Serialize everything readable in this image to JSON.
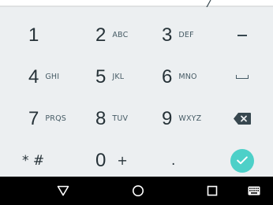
{
  "keypad": {
    "rows": [
      [
        {
          "num": "1",
          "sub": ""
        },
        {
          "num": "2",
          "sub": "ABC"
        },
        {
          "num": "3",
          "sub": "DEF"
        }
      ],
      [
        {
          "num": "4",
          "sub": "GHI"
        },
        {
          "num": "5",
          "sub": "JKL"
        },
        {
          "num": "6",
          "sub": "MNO"
        }
      ],
      [
        {
          "num": "7",
          "sub": "PRQS"
        },
        {
          "num": "8",
          "sub": "TUV"
        },
        {
          "num": "9",
          "sub": "WXYZ"
        }
      ]
    ],
    "bottom": {
      "star_hash": "* #",
      "zero": "0",
      "plus": "+",
      "period": "."
    },
    "side_keys": [
      "minus-key",
      "space-key",
      "backspace-key",
      "enter-key"
    ],
    "enter_color": "#4dd0c8",
    "background_color": "#eceff1"
  },
  "navbar": {
    "icons": [
      "back-icon",
      "home-icon",
      "recents-icon",
      "keyboard-icon"
    ],
    "background_color": "#000000"
  }
}
